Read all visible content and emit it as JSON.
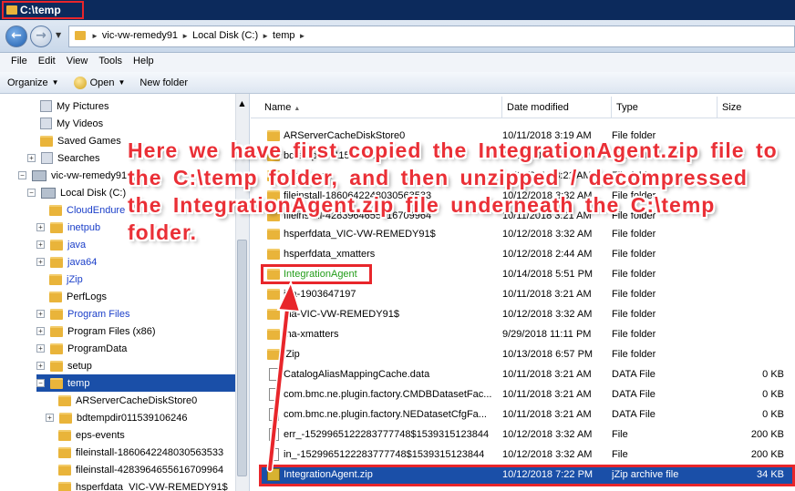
{
  "window": {
    "title": "C:\\temp"
  },
  "address": {
    "crumbs": [
      "vic-vw-remedy91",
      "Local Disk (C:)",
      "temp"
    ]
  },
  "menu": [
    "File",
    "Edit",
    "View",
    "Tools",
    "Help"
  ],
  "commands": {
    "organize": "Organize",
    "open": "Open",
    "new_folder": "New folder"
  },
  "tree": [
    {
      "label": "My Pictures",
      "icon": "pictures-icon"
    },
    {
      "label": "My Videos",
      "icon": "videos-icon"
    },
    {
      "label": "Saved Games",
      "icon": "games-icon"
    },
    {
      "label": "Searches",
      "icon": "search-folder-icon"
    },
    {
      "label": "vic-vw-remedy91",
      "icon": "computer-icon"
    },
    {
      "label": "Local Disk (C:)",
      "icon": "disk-icon"
    },
    {
      "label": "CloudEndure",
      "icon": "folder-icon"
    },
    {
      "label": "inetpub",
      "icon": "folder-icon"
    },
    {
      "label": "java",
      "icon": "folder-icon"
    },
    {
      "label": "java64",
      "icon": "folder-icon"
    },
    {
      "label": "jZip",
      "icon": "folder-icon"
    },
    {
      "label": "PerfLogs",
      "icon": "folder-icon"
    },
    {
      "label": "Program Files",
      "icon": "folder-icon"
    },
    {
      "label": "Program Files (x86)",
      "icon": "folder-icon"
    },
    {
      "label": "ProgramData",
      "icon": "folder-icon"
    },
    {
      "label": "setup",
      "icon": "folder-icon"
    },
    {
      "label": "temp",
      "icon": "folder-icon"
    },
    {
      "label": "ARServerCacheDiskStore0",
      "icon": "folder-icon"
    },
    {
      "label": "bdtempdir011539106246",
      "icon": "folder-icon"
    },
    {
      "label": "eps-events",
      "icon": "folder-icon"
    },
    {
      "label": "fileinstall-1860642248030563533",
      "icon": "folder-icon"
    },
    {
      "label": "fileinstall-4283964655616709964",
      "icon": "folder-icon"
    },
    {
      "label": "hsperfdata_VIC-VW-REMEDY91$",
      "icon": "folder-icon"
    }
  ],
  "columns": {
    "name": "Name",
    "date": "Date modified",
    "type": "Type",
    "size": "Size"
  },
  "files": [
    {
      "name": "ARServerCacheDiskStore0",
      "date": "10/11/2018 3:19 AM",
      "type": "File folder",
      "size": ""
    },
    {
      "name": "bdtempdir011539106246",
      "date": "10/10/2018 3:44 AM",
      "type": "File folder",
      "size": ""
    },
    {
      "name": "eps-events",
      "date": "10/11/2018 3:21 AM",
      "type": "File folder",
      "size": ""
    },
    {
      "name": "fileinstall-1860642248030563533",
      "date": "10/12/2018 3:32 AM",
      "type": "File folder",
      "size": ""
    },
    {
      "name": "fileinstall-4283964655616709964",
      "date": "10/11/2018 3:21 AM",
      "type": "File folder",
      "size": ""
    },
    {
      "name": "hsperfdata_VIC-VW-REMEDY91$",
      "date": "10/12/2018 3:32 AM",
      "type": "File folder",
      "size": ""
    },
    {
      "name": "hsperfdata_xmatters",
      "date": "10/12/2018 2:44 AM",
      "type": "File folder",
      "size": ""
    },
    {
      "name": "IntegrationAgent",
      "date": "10/14/2018 5:51 PM",
      "type": "File folder",
      "size": ""
    },
    {
      "name": "jna-1903647197",
      "date": "10/11/2018 3:21 AM",
      "type": "File folder",
      "size": ""
    },
    {
      "name": "jna-VIC-VW-REMEDY91$",
      "date": "10/12/2018 3:32 AM",
      "type": "File folder",
      "size": ""
    },
    {
      "name": "jna-xmatters",
      "date": "9/29/2018 11:11 PM",
      "type": "File folder",
      "size": ""
    },
    {
      "name": "jZip",
      "date": "10/13/2018 6:57 PM",
      "type": "File folder",
      "size": ""
    },
    {
      "name": "CatalogAliasMappingCache.data",
      "date": "10/11/2018 3:21 AM",
      "type": "DATA File",
      "size": "0 KB"
    },
    {
      "name": "com.bmc.ne.plugin.factory.CMDBDatasetFac...",
      "date": "10/11/2018 3:21 AM",
      "type": "DATA File",
      "size": "0 KB"
    },
    {
      "name": "com.bmc.ne.plugin.factory.NEDatasetCfgFa...",
      "date": "10/11/2018 3:21 AM",
      "type": "DATA File",
      "size": "0 KB"
    },
    {
      "name": "err_-1529965122283777748$1539315123844",
      "date": "10/12/2018 3:32 AM",
      "type": "File",
      "size": "200 KB"
    },
    {
      "name": "in_-1529965122283777748$1539315123844",
      "date": "10/12/2018 3:32 AM",
      "type": "File",
      "size": "200 KB"
    },
    {
      "name": "IntegrationAgent.zip",
      "date": "10/12/2018 7:22 PM",
      "type": "jZip archive file",
      "size": "34 KB"
    }
  ],
  "callout": "Here we have first copied the IntegrationAgent.zip file to the C:\\temp folder, and then unzipped / decompressed the IntegrationAgent.zip file underneath the C:\\temp folder.",
  "colors": {
    "titlebar": "#0c2a5c",
    "selection": "#1a4fa8",
    "annotation": "#e8262b"
  }
}
